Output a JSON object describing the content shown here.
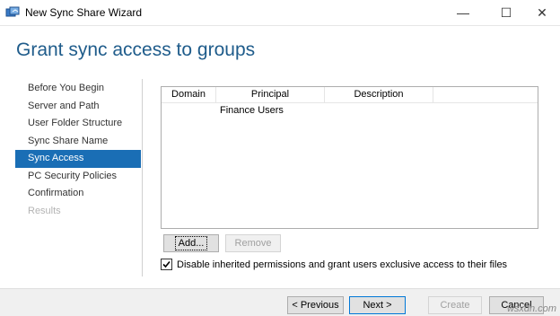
{
  "window": {
    "title": "New Sync Share Wizard",
    "minimize_glyph": "—",
    "maximize_glyph": "☐",
    "close_glyph": "✕"
  },
  "page": {
    "heading": "Grant sync access to groups"
  },
  "nav": {
    "items": [
      {
        "label": "Before You Begin",
        "state": "normal"
      },
      {
        "label": "Server and Path",
        "state": "normal"
      },
      {
        "label": "User Folder Structure",
        "state": "normal"
      },
      {
        "label": "Sync Share Name",
        "state": "normal"
      },
      {
        "label": "Sync Access",
        "state": "active"
      },
      {
        "label": "PC Security Policies",
        "state": "normal"
      },
      {
        "label": "Confirmation",
        "state": "normal"
      },
      {
        "label": "Results",
        "state": "disabled"
      }
    ]
  },
  "list": {
    "columns": [
      "Domain",
      "Principal",
      "Description"
    ],
    "rows": [
      {
        "domain": "",
        "principal": "Finance Users",
        "description": ""
      }
    ]
  },
  "buttons": {
    "add": "Add...",
    "remove": "Remove",
    "previous": "< Previous",
    "next": "Next >",
    "create": "Create",
    "cancel": "Cancel"
  },
  "checkbox": {
    "label": "Disable inherited permissions and grant users exclusive access to their files",
    "checked": true
  },
  "watermark": "wsxdn.com",
  "colors": {
    "accent": "#1a6eb5",
    "heading": "#1f5c8b"
  }
}
